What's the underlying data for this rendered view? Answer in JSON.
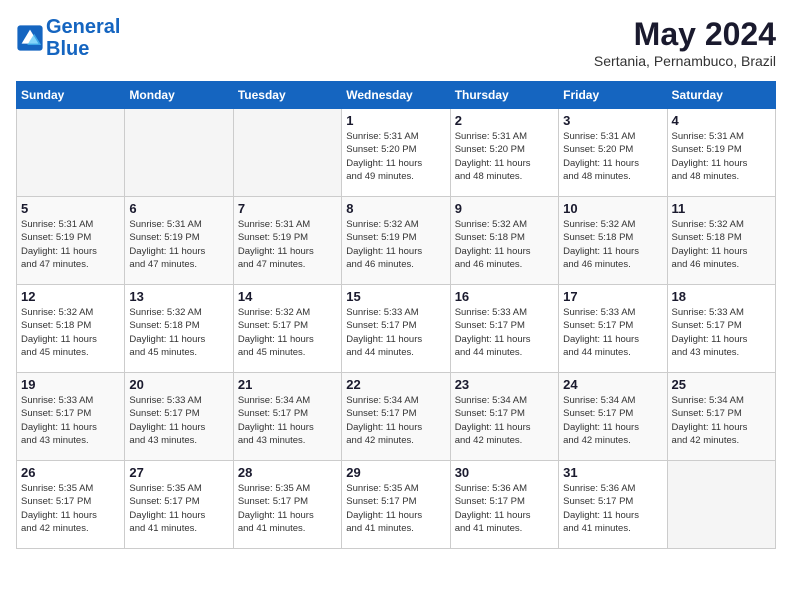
{
  "header": {
    "logo_line1": "General",
    "logo_line2": "Blue",
    "month_title": "May 2024",
    "location": "Sertania, Pernambuco, Brazil"
  },
  "days_of_week": [
    "Sunday",
    "Monday",
    "Tuesday",
    "Wednesday",
    "Thursday",
    "Friday",
    "Saturday"
  ],
  "weeks": [
    [
      {
        "num": "",
        "info": ""
      },
      {
        "num": "",
        "info": ""
      },
      {
        "num": "",
        "info": ""
      },
      {
        "num": "1",
        "info": "Sunrise: 5:31 AM\nSunset: 5:20 PM\nDaylight: 11 hours\nand 49 minutes."
      },
      {
        "num": "2",
        "info": "Sunrise: 5:31 AM\nSunset: 5:20 PM\nDaylight: 11 hours\nand 48 minutes."
      },
      {
        "num": "3",
        "info": "Sunrise: 5:31 AM\nSunset: 5:20 PM\nDaylight: 11 hours\nand 48 minutes."
      },
      {
        "num": "4",
        "info": "Sunrise: 5:31 AM\nSunset: 5:19 PM\nDaylight: 11 hours\nand 48 minutes."
      }
    ],
    [
      {
        "num": "5",
        "info": "Sunrise: 5:31 AM\nSunset: 5:19 PM\nDaylight: 11 hours\nand 47 minutes."
      },
      {
        "num": "6",
        "info": "Sunrise: 5:31 AM\nSunset: 5:19 PM\nDaylight: 11 hours\nand 47 minutes."
      },
      {
        "num": "7",
        "info": "Sunrise: 5:31 AM\nSunset: 5:19 PM\nDaylight: 11 hours\nand 47 minutes."
      },
      {
        "num": "8",
        "info": "Sunrise: 5:32 AM\nSunset: 5:19 PM\nDaylight: 11 hours\nand 46 minutes."
      },
      {
        "num": "9",
        "info": "Sunrise: 5:32 AM\nSunset: 5:18 PM\nDaylight: 11 hours\nand 46 minutes."
      },
      {
        "num": "10",
        "info": "Sunrise: 5:32 AM\nSunset: 5:18 PM\nDaylight: 11 hours\nand 46 minutes."
      },
      {
        "num": "11",
        "info": "Sunrise: 5:32 AM\nSunset: 5:18 PM\nDaylight: 11 hours\nand 46 minutes."
      }
    ],
    [
      {
        "num": "12",
        "info": "Sunrise: 5:32 AM\nSunset: 5:18 PM\nDaylight: 11 hours\nand 45 minutes."
      },
      {
        "num": "13",
        "info": "Sunrise: 5:32 AM\nSunset: 5:18 PM\nDaylight: 11 hours\nand 45 minutes."
      },
      {
        "num": "14",
        "info": "Sunrise: 5:32 AM\nSunset: 5:17 PM\nDaylight: 11 hours\nand 45 minutes."
      },
      {
        "num": "15",
        "info": "Sunrise: 5:33 AM\nSunset: 5:17 PM\nDaylight: 11 hours\nand 44 minutes."
      },
      {
        "num": "16",
        "info": "Sunrise: 5:33 AM\nSunset: 5:17 PM\nDaylight: 11 hours\nand 44 minutes."
      },
      {
        "num": "17",
        "info": "Sunrise: 5:33 AM\nSunset: 5:17 PM\nDaylight: 11 hours\nand 44 minutes."
      },
      {
        "num": "18",
        "info": "Sunrise: 5:33 AM\nSunset: 5:17 PM\nDaylight: 11 hours\nand 43 minutes."
      }
    ],
    [
      {
        "num": "19",
        "info": "Sunrise: 5:33 AM\nSunset: 5:17 PM\nDaylight: 11 hours\nand 43 minutes."
      },
      {
        "num": "20",
        "info": "Sunrise: 5:33 AM\nSunset: 5:17 PM\nDaylight: 11 hours\nand 43 minutes."
      },
      {
        "num": "21",
        "info": "Sunrise: 5:34 AM\nSunset: 5:17 PM\nDaylight: 11 hours\nand 43 minutes."
      },
      {
        "num": "22",
        "info": "Sunrise: 5:34 AM\nSunset: 5:17 PM\nDaylight: 11 hours\nand 42 minutes."
      },
      {
        "num": "23",
        "info": "Sunrise: 5:34 AM\nSunset: 5:17 PM\nDaylight: 11 hours\nand 42 minutes."
      },
      {
        "num": "24",
        "info": "Sunrise: 5:34 AM\nSunset: 5:17 PM\nDaylight: 11 hours\nand 42 minutes."
      },
      {
        "num": "25",
        "info": "Sunrise: 5:34 AM\nSunset: 5:17 PM\nDaylight: 11 hours\nand 42 minutes."
      }
    ],
    [
      {
        "num": "26",
        "info": "Sunrise: 5:35 AM\nSunset: 5:17 PM\nDaylight: 11 hours\nand 42 minutes."
      },
      {
        "num": "27",
        "info": "Sunrise: 5:35 AM\nSunset: 5:17 PM\nDaylight: 11 hours\nand 41 minutes."
      },
      {
        "num": "28",
        "info": "Sunrise: 5:35 AM\nSunset: 5:17 PM\nDaylight: 11 hours\nand 41 minutes."
      },
      {
        "num": "29",
        "info": "Sunrise: 5:35 AM\nSunset: 5:17 PM\nDaylight: 11 hours\nand 41 minutes."
      },
      {
        "num": "30",
        "info": "Sunrise: 5:36 AM\nSunset: 5:17 PM\nDaylight: 11 hours\nand 41 minutes."
      },
      {
        "num": "31",
        "info": "Sunrise: 5:36 AM\nSunset: 5:17 PM\nDaylight: 11 hours\nand 41 minutes."
      },
      {
        "num": "",
        "info": ""
      }
    ]
  ]
}
